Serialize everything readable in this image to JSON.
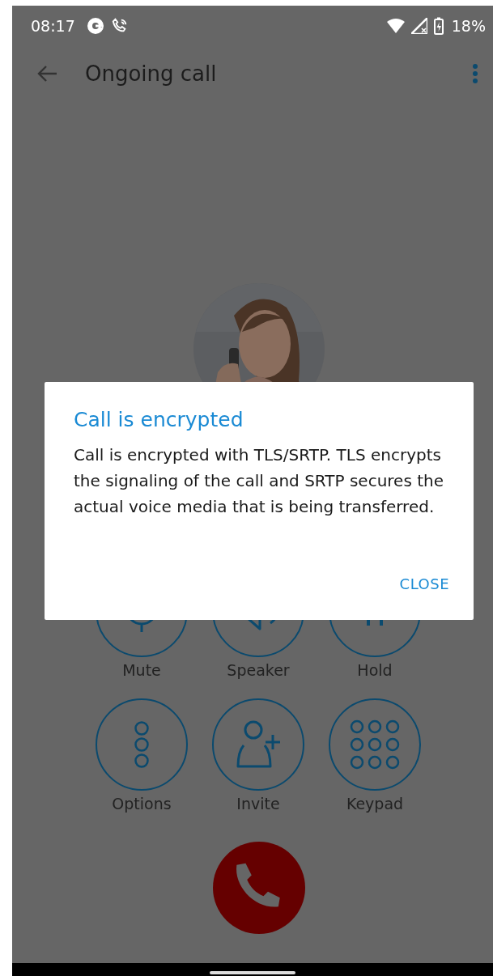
{
  "status_bar": {
    "time": "08:17",
    "battery": "18%"
  },
  "app_bar": {
    "title": "Ongoing call"
  },
  "controls": [
    {
      "label": "Mute",
      "kind": "mute"
    },
    {
      "label": "Speaker",
      "kind": "speaker"
    },
    {
      "label": "Hold",
      "kind": "hold"
    },
    {
      "label": "Options",
      "kind": "options"
    },
    {
      "label": "Invite",
      "kind": "invite"
    },
    {
      "label": "Keypad",
      "kind": "keypad"
    }
  ],
  "dialog": {
    "title": "Call is encrypted",
    "message": "Call is encrypted with TLS/SRTP. TLS encrypts the signaling of the call and SRTP secures the actual voice media that is being transferred.",
    "button": "CLOSE"
  }
}
